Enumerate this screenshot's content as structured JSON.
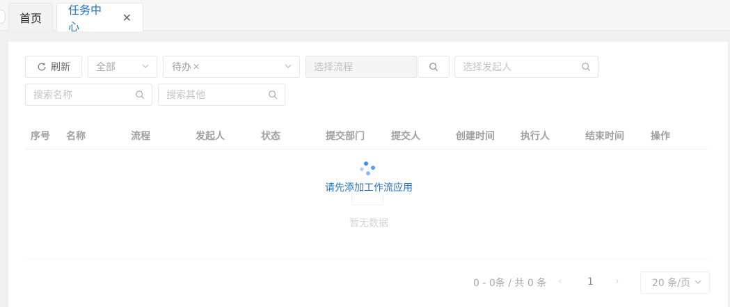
{
  "tabs": [
    {
      "label": "首页"
    },
    {
      "label": "任务中心"
    }
  ],
  "toolbar": {
    "refresh_label": "刷新",
    "scope_select": "全部",
    "status_tag": "待办",
    "flow_placeholder": "选择流程",
    "initiator_placeholder": "选择发起人",
    "name_placeholder": "搜索名称",
    "other_placeholder": "搜索其他"
  },
  "table": {
    "columns": [
      "序号",
      "名称",
      "流程",
      "发起人",
      "状态",
      "提交部门",
      "提交人",
      "创建时间",
      "执行人",
      "结束时间",
      "操作"
    ],
    "loading_text": "请先添加工作流应用",
    "empty_text": "暂无数据"
  },
  "pagination": {
    "total_text": "0 - 0条 / 共 0 条",
    "page": "1",
    "page_size": "20 条/页"
  },
  "colors": {
    "accent": "#1f74c9",
    "spinner": "#3d8cf2"
  },
  "icons": [
    "refresh-icon",
    "chevron-down-icon",
    "search-icon",
    "close-icon",
    "loading-spinner-icon"
  ]
}
